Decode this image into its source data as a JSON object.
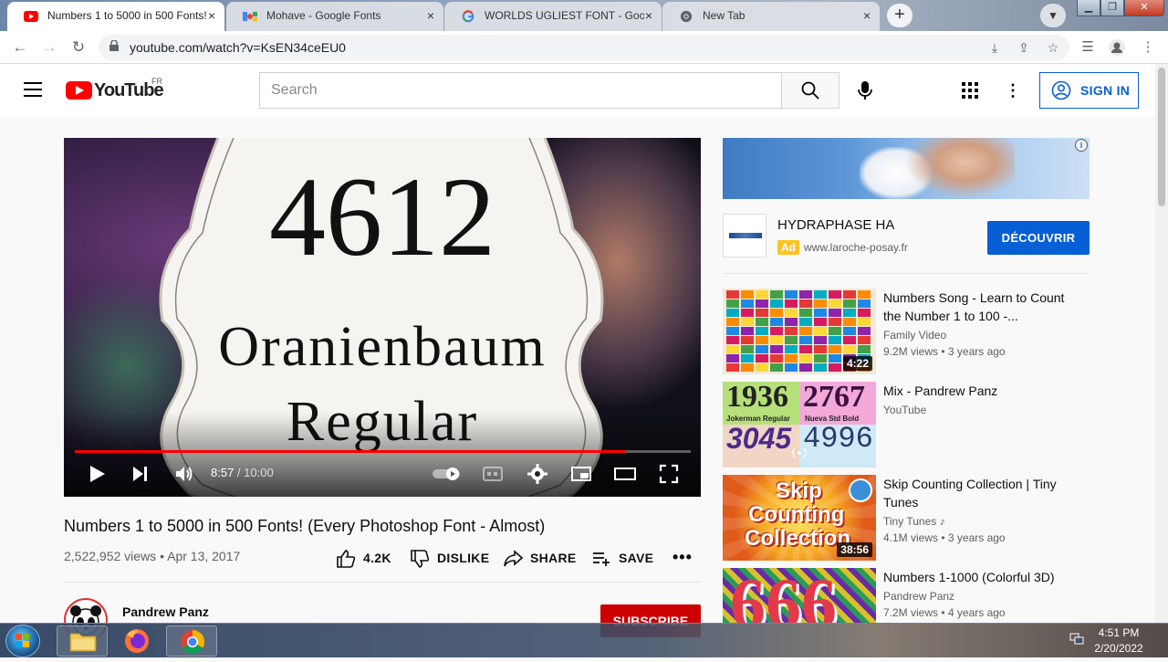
{
  "browser": {
    "tabs": [
      {
        "label": "Numbers 1 to 5000 in 500 Fonts!",
        "favicon": "youtube-icon",
        "active": true
      },
      {
        "label": "Mohave - Google Fonts",
        "favicon": "google-fonts-icon",
        "active": false
      },
      {
        "label": "WORLDS UGLIEST FONT - Goog",
        "favicon": "google-icon",
        "active": false
      },
      {
        "label": "New Tab",
        "favicon": "chrome-icon",
        "active": false
      }
    ],
    "tab_close_glyph": "×",
    "new_tab_glyph": "+",
    "url": "youtube.com/watch?v=KsEN34ceEU0"
  },
  "youtube": {
    "logo_text": "YouTube",
    "country_code": "FR",
    "search_placeholder": "Search",
    "signin_label": "SIGN IN"
  },
  "player": {
    "frame_number": "4612",
    "frame_font_name": "Oranienbaum",
    "frame_font_style": "Regular",
    "current_time": "8:57",
    "total_time": "10:00",
    "progress_fraction": 0.895,
    "accent": "#ff0000"
  },
  "video": {
    "title": "Numbers 1 to 5000 in 500 Fonts! (Every Photoshop Font - Almost)",
    "views": "2,522,952 views",
    "date": "Apr 13, 2017",
    "likes": "4.2K",
    "dislike_label": "DISLIKE",
    "share_label": "SHARE",
    "save_label": "SAVE",
    "channel": "Pandrew Panz",
    "subscribe_label": "SUBSCRIBE"
  },
  "ad": {
    "title": "HYDRAPHASE HA",
    "badge": "Ad",
    "url": "www.laroche-posay.fr",
    "cta": "DÉCOUVRIR",
    "info_glyph": "i"
  },
  "recommendations": [
    {
      "title": "Numbers Song - Learn to Count the Number 1 to 100 -...",
      "channel": "Family Video",
      "stats": "9.2M views • 3 years ago",
      "duration": "4:22"
    },
    {
      "title": "Mix - Pandrew Panz",
      "channel": "YouTube",
      "stats": "",
      "duration": "",
      "thumb_texts": [
        "1936",
        "2767",
        "3045",
        "4996",
        "Jokerman Regular",
        "Nueva Std Bold"
      ]
    },
    {
      "title": "Skip Counting Collection | Tiny Tunes",
      "channel": "Tiny Tunes",
      "stats": "4.1M views • 3 years ago",
      "duration": "38:56",
      "thumb_texts": [
        "Skip",
        "Counting",
        "Collection"
      ]
    },
    {
      "title": "Numbers 1-1000 (Colorful 3D)",
      "channel": "Pandrew Panz",
      "stats": "7.2M views • 4 years ago",
      "duration": "",
      "thumb_texts": [
        "666"
      ]
    }
  ],
  "taskbar": {
    "time": "4:51 PM",
    "date": "2/20/2022"
  }
}
